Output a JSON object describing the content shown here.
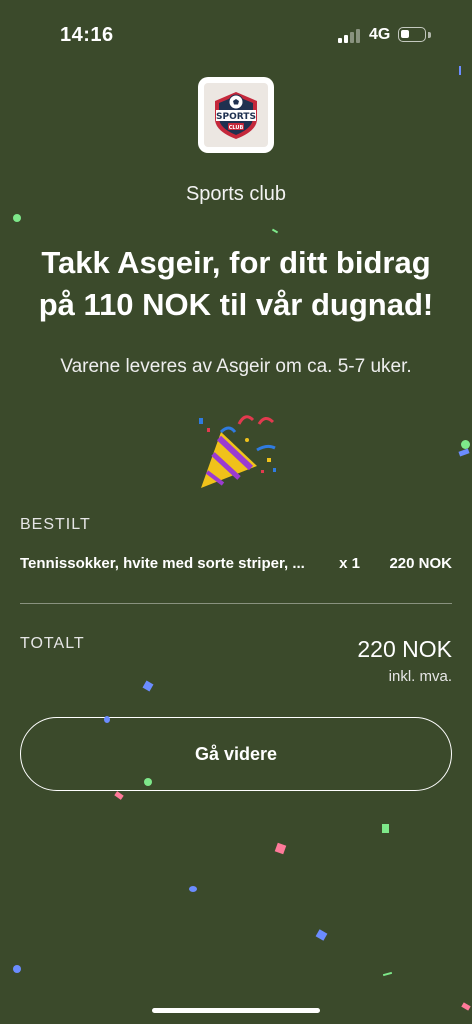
{
  "status_bar": {
    "time": "14:16",
    "network": "4G",
    "signal_bars": 2,
    "battery_level": 0.25
  },
  "logo": {
    "line1": "SPORTS",
    "line2": "CLUB"
  },
  "club_name": "Sports club",
  "headline": "Takk Asgeir, for ditt bidrag på 110 NOK til vår dugnad!",
  "subtext": "Varene leveres av Asgeir om ca. 5-7 uker.",
  "emoji_icon": "party-popper-icon",
  "order": {
    "section_label": "BESTILT",
    "items": [
      {
        "name": "Tennissokker, hvite med sorte striper, ...",
        "quantity": "x 1",
        "price": "220 NOK"
      }
    ]
  },
  "total": {
    "label": "TOTALT",
    "amount": "220 NOK",
    "note": "inkl. mva."
  },
  "cta": {
    "label": "Gå videre"
  },
  "colors": {
    "background": "#3b4a2b",
    "text": "#ffffff",
    "logo_navy": "#1f3150",
    "logo_red": "#c4283b"
  }
}
